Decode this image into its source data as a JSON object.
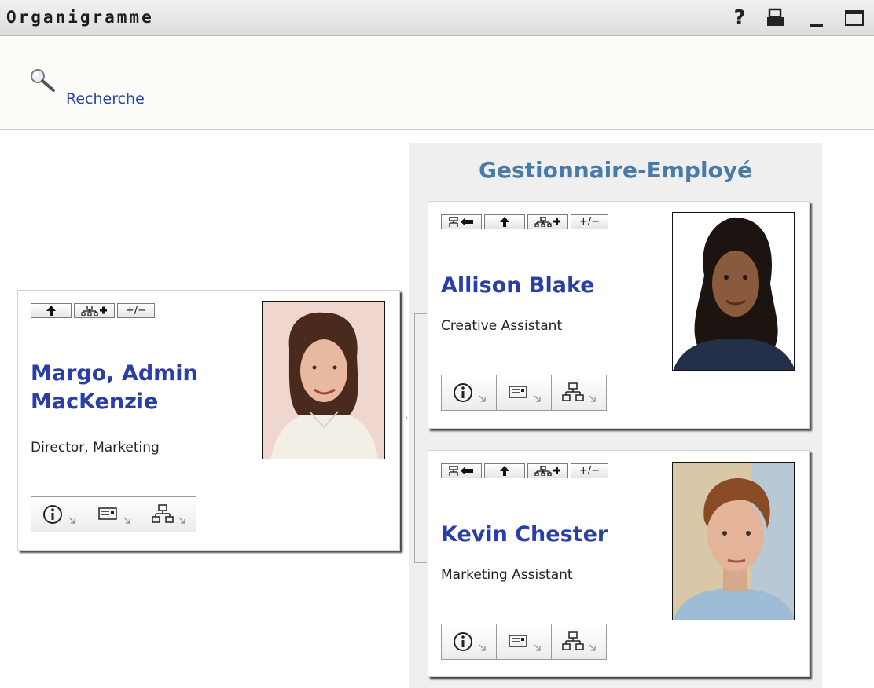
{
  "window": {
    "title": "Organigramme"
  },
  "search": {
    "link_label": "Recherche"
  },
  "panel": {
    "title": "Gestionnaire-Employé"
  },
  "cards": {
    "margo": {
      "name_line1": "Margo, Admin",
      "name_line2": "MacKenzie",
      "role": "Director, Marketing"
    },
    "allison": {
      "name": "Allison Blake",
      "role": "Creative Assistant"
    },
    "kevin": {
      "name": "Kevin Chester",
      "role": "Marketing Assistant"
    }
  },
  "toolbar": {
    "expand_label": "+/−"
  },
  "icons": {
    "titlebar": [
      "help-icon",
      "print-icon",
      "minimize-icon",
      "maximize-icon"
    ],
    "card_tools": [
      "back-to-manager-icon",
      "up-arrow-icon",
      "show-reports-icon",
      "expand-collapse-icon"
    ],
    "card_actions": [
      "info-icon",
      "email-icon",
      "org-chart-icon"
    ]
  },
  "colors": {
    "name_link": "#2a3ea8",
    "panel_title": "#4a7aa8",
    "panel_bg": "#efefef"
  }
}
